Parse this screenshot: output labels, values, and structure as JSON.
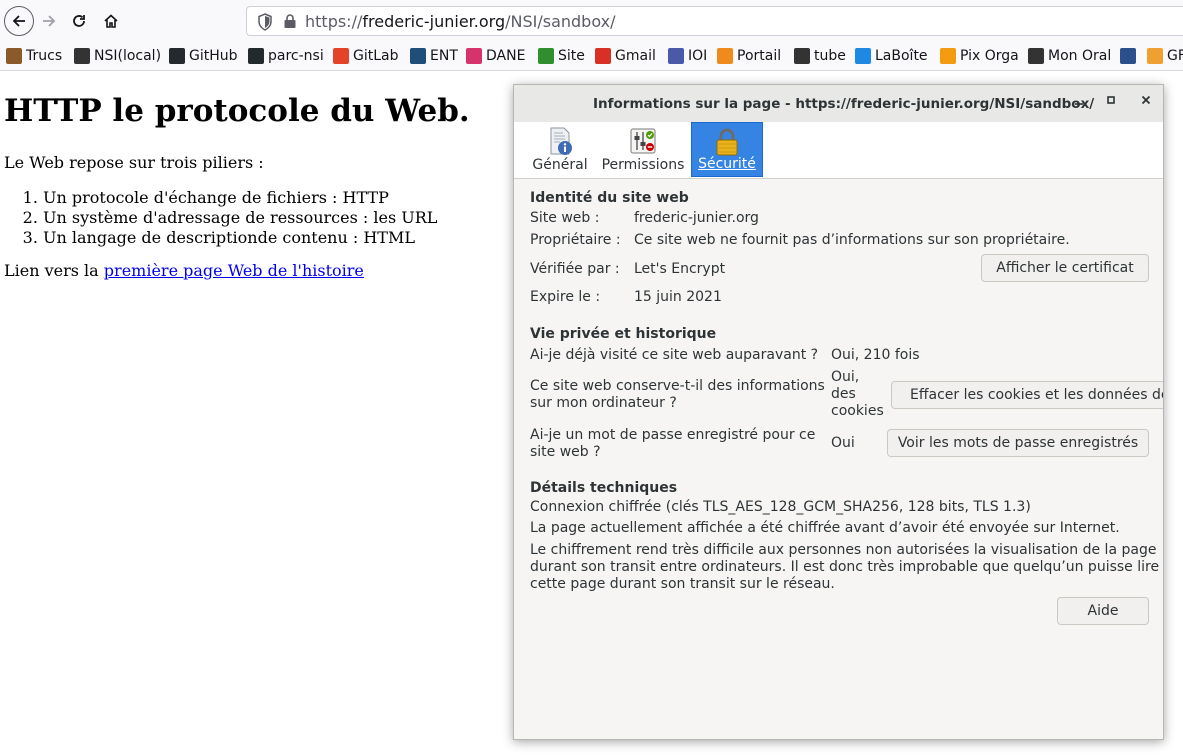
{
  "browser": {
    "url_prefix": "https://",
    "url_host": "frederic-junier.org",
    "url_path": "/NSI/sandbox/"
  },
  "bookmarks": [
    {
      "label": "Trucs",
      "icon": "avatar-icon",
      "color": "#8b5a2b"
    },
    {
      "label": "NSI(local)",
      "icon": "globe-icon",
      "color": "#333333"
    },
    {
      "label": "GitHub",
      "icon": "github-icon",
      "color": "#24292e"
    },
    {
      "label": "parc-nsi",
      "icon": "github-icon",
      "color": "#24292e"
    },
    {
      "label": "GitLab",
      "icon": "gitlab-icon",
      "color": "#e24329"
    },
    {
      "label": "ENT",
      "icon": "ent-icon",
      "color": "#1f4e79"
    },
    {
      "label": "DANE",
      "icon": "dane-icon",
      "color": "#d6336c"
    },
    {
      "label": "Site",
      "icon": "site-icon",
      "color": "#2f8f2f"
    },
    {
      "label": "Gmail",
      "icon": "gmail-icon",
      "color": "#d93025"
    },
    {
      "label": "IOI",
      "icon": "ioi-icon",
      "color": "#4a5aa8"
    },
    {
      "label": "Portail",
      "icon": "portail-icon",
      "color": "#f08a1c"
    },
    {
      "label": "tube",
      "icon": "play-icon",
      "color": "#333333"
    },
    {
      "label": "LaBoîte",
      "icon": "laboite-icon",
      "color": "#1e88e5"
    },
    {
      "label": "Pix Orga",
      "icon": "pix-icon",
      "color": "#f39c12"
    },
    {
      "label": "Mon Oral",
      "icon": "globe-icon",
      "color": "#333333"
    },
    {
      "label": "",
      "icon": "bookmark-icon",
      "color": "#2b4f8a"
    },
    {
      "label": "GF",
      "icon": "gf-icon",
      "color": "#f0a030"
    }
  ],
  "page": {
    "title": "HTTP le protocole du Web.",
    "intro": "Le Web repose sur trois piliers :",
    "pillars": [
      "Un protocole d'échange de fichiers : HTTP",
      "Un système d'adressage de ressources : les URL",
      "Un langage de descriptionde contenu : HTML"
    ],
    "link_prefix": "Lien vers la ",
    "link_text": "première page Web de l'histoire"
  },
  "dialog": {
    "title": "Informations sur la page - https://frederic-junier.org/NSI/sandbox/",
    "tabs": [
      {
        "label": "Général",
        "icon": "info-icon"
      },
      {
        "label": "Permissions",
        "icon": "permissions-icon"
      },
      {
        "label": "Sécurité",
        "icon": "padlock-icon",
        "selected": true
      }
    ],
    "identity": {
      "heading": "Identité du site web",
      "site_label": "Site web :",
      "site_value": "frederic-junier.org",
      "owner_label": "Propriétaire :",
      "owner_value": "Ce site web ne fournit pas d’informations sur son propriétaire.",
      "verified_label": "Vérifiée par :",
      "verified_value": "Let's Encrypt",
      "expires_label": "Expire le :",
      "expires_value": "15 juin 2021",
      "cert_button": "Afficher le certificat"
    },
    "privacy": {
      "heading": "Vie privée et historique",
      "q1": "Ai-je déjà visité ce site web auparavant ?",
      "a1": "Oui, 210 fois",
      "q2_line1": "Ce site web conserve-t-il des informations",
      "q2_line2": "sur mon ordinateur ?",
      "a2_line1": "Oui,",
      "a2_line2": "des",
      "a2_line3": "cookies",
      "clear_button": "Effacer les cookies et les données de s",
      "q3_line1": "Ai-je un mot de passe enregistré pour ce",
      "q3_line2": "site web ?",
      "a3": "Oui",
      "passwords_button": "Voir les mots de passe enregistrés"
    },
    "technical": {
      "heading": "Détails techniques",
      "connection": "Connexion chiffrée (clés TLS_AES_128_GCM_SHA256, 128 bits, TLS 1.3)",
      "line2": "La page actuellement affichée a été chiffrée avant d’avoir été envoyée sur Internet.",
      "line3a": "Le chiffrement rend très difficile aux personnes non autorisées la visualisation de la page",
      "line3b": "durant son transit entre ordinateurs. Il est donc très improbable que quelqu’un puisse lire",
      "line3c": "cette page durant son transit sur le réseau."
    },
    "help_button": "Aide"
  }
}
